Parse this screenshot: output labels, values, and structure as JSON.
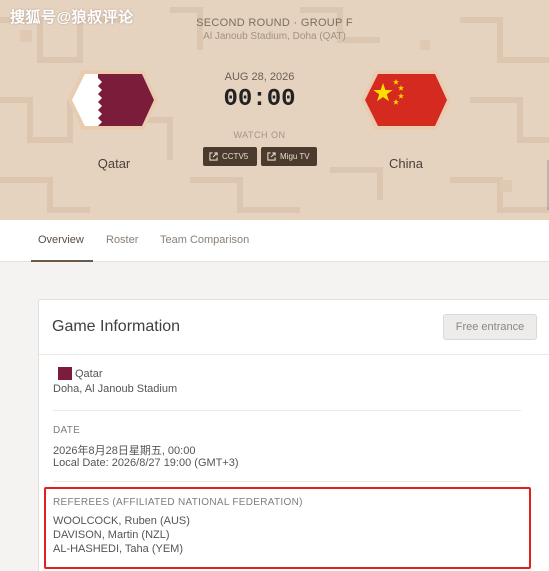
{
  "watermark": "搜狐号@狼叔评论",
  "match": {
    "round": "SECOND ROUND · GROUP F",
    "stadium": "Al Janoub Stadium, Doha (QAT)",
    "date": "AUG 28, 2026",
    "time": "00:00",
    "watch_on": "WATCH ON",
    "channels": [
      "CCTV5",
      "Migu TV"
    ],
    "home": {
      "name": "Qatar",
      "flag_color": "#7b1c3a"
    },
    "away": {
      "name": "China",
      "flag_color": "#d42a1f"
    }
  },
  "tabs": [
    {
      "label": "Overview",
      "active": true
    },
    {
      "label": "Roster",
      "active": false
    },
    {
      "label": "Team Comparison",
      "active": false
    }
  ],
  "game_info": {
    "title": "Game Information",
    "free_label": "Free entrance",
    "host_country": "Qatar",
    "venue": "Doha, Al Janoub Stadium",
    "date_label": "DATE",
    "date_value": "2026年8月28日星期五, 00:00",
    "local_date": "Local Date: 2026/8/27 19:00 (GMT+3)",
    "referees_label": "REFEREES (AFFILIATED NATIONAL FEDERATION)",
    "referees": [
      "WOOLCOCK, Ruben (AUS)",
      "DAVISON, Martin (NZL)",
      "AL-HASHEDI, Taha (YEM)"
    ]
  },
  "colors": {
    "accent": "#6a5a4c",
    "highlight": "#e02020",
    "banner": "#e6d3bf"
  }
}
